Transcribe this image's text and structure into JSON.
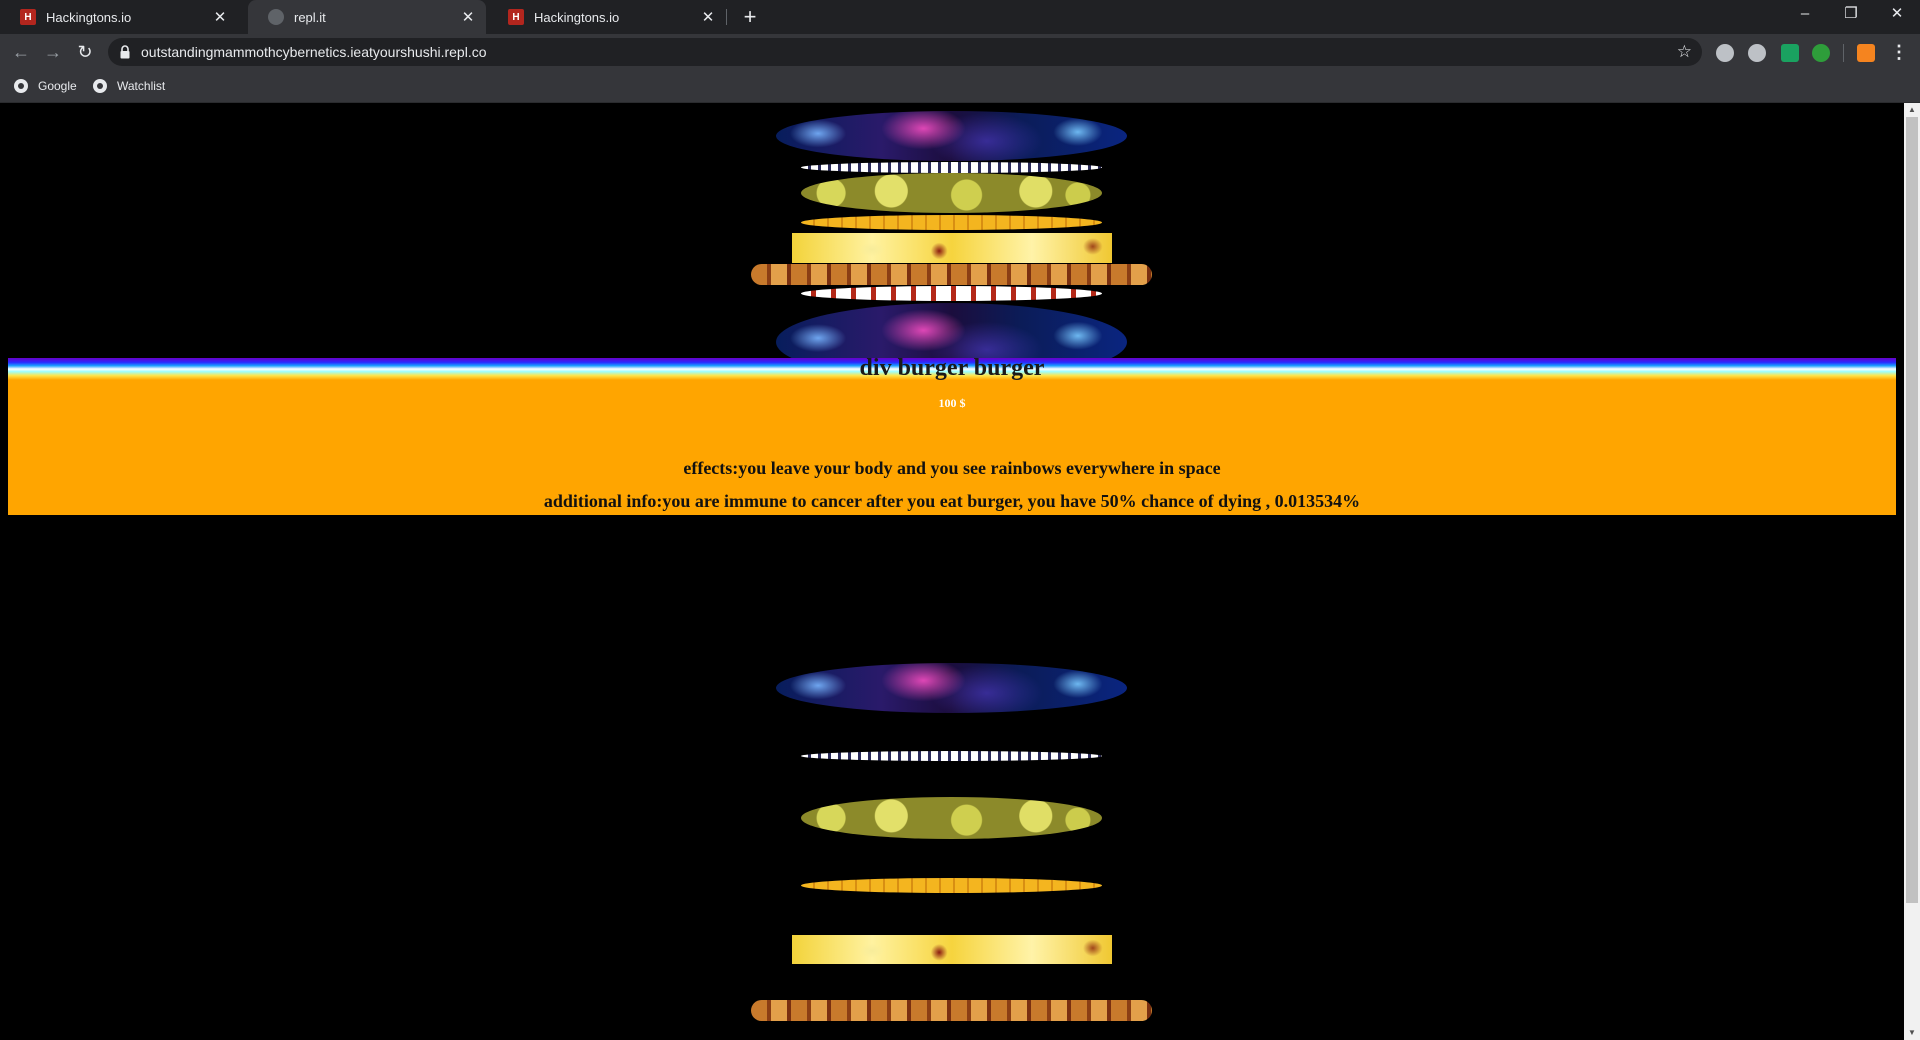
{
  "tabs": [
    {
      "title": "Hackingtons.io",
      "favicon": "hackingtons-icon",
      "active": false
    },
    {
      "title": "repl.it",
      "favicon": "globe-icon",
      "active": true
    },
    {
      "title": "Hackingtons.io",
      "favicon": "hackingtons-icon",
      "active": false
    }
  ],
  "tab_glyphs": {
    "close": "✕",
    "new_tab": "+",
    "hackingtons_letter": "H"
  },
  "window_controls": {
    "minimize": "–",
    "restore": "❐",
    "close": "✕"
  },
  "nav": {
    "back": "←",
    "forward": "→",
    "reload": "↻"
  },
  "address_bar": {
    "url": "outstandingmammothcybernetics.ieatyourshushi.repl.co",
    "star": "☆"
  },
  "extensions": [
    {
      "name": "drive-icon",
      "color": "#bdc1c6"
    },
    {
      "name": "extension-icon",
      "color": "#bdc1c6"
    },
    {
      "name": "translate-icon",
      "color": "#1aa260"
    },
    {
      "name": "adblock-icon",
      "color": "#2e9d3a"
    },
    {
      "name": "metamask-icon",
      "color": "#f5841f"
    }
  ],
  "menu_glyph": "⋮",
  "bookmarks": [
    {
      "label": "Google",
      "icon": "globe-icon"
    },
    {
      "label": "Watchlist",
      "icon": "globe-icon"
    }
  ],
  "page": {
    "title": "div burger burger",
    "price": "100 $",
    "effects": "effects:you leave your body and you see rainbows everywhere in space",
    "additional_info": "additional info:you are immune to cancer after you eat burger, you have 50% chance of dying , 0.013534%"
  },
  "scrollbar_glyphs": {
    "up": "▲",
    "down": "▼"
  }
}
